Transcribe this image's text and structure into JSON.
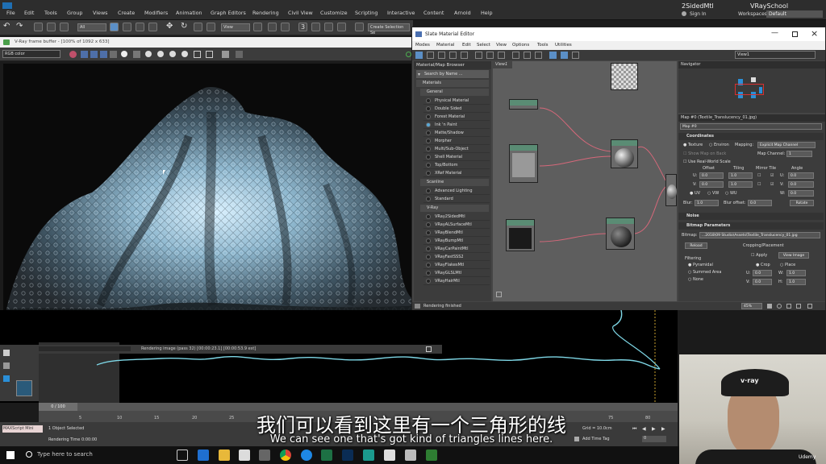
{
  "app": {
    "title_file": "2SidedMtl",
    "title_account": "VRaySchool",
    "sign_in": "Sign In",
    "workspaces_label": "Workspaces:",
    "workspaces_value": "Default"
  },
  "main_menu": [
    "File",
    "Edit",
    "Tools",
    "Group",
    "Views",
    "Create",
    "Modifiers",
    "Animation",
    "Graph Editors",
    "Rendering",
    "Civil View",
    "Customize",
    "Scripting",
    "Interactive",
    "Content",
    "Arnold",
    "Help"
  ],
  "toolbar": {
    "selection_filter": "All",
    "view_dropdown": "View",
    "create_selection_set": "Create Selection Se"
  },
  "frame_buffer": {
    "title": "V-Ray frame buffer - [100% of 1092 x 633]",
    "channel": "RGB color",
    "status": "Rendering image (pass 32) [00:00:23.1] [00:00:53.9 est]"
  },
  "slate": {
    "title": "Slate Material Editor",
    "menus": [
      "Modes",
      "Material",
      "Edit",
      "Select",
      "View",
      "Options",
      "Tools",
      "Utilities"
    ],
    "browser_title": "Material/Map Browser",
    "search_placeholder": "Search by Name ...",
    "materials_header": "Materials",
    "general_header": "General",
    "general_items": [
      "Physical Material",
      "Double Sided",
      "Forest Material",
      "Ink 'n Paint",
      "Matte/Shadow",
      "Morpher",
      "Multi/Sub-Object",
      "Shell Material",
      "Top/Bottom",
      "XRef Material"
    ],
    "scanline_header": "Scanline",
    "scanline_items": [
      "Advanced Lighting",
      "Standard"
    ],
    "vray_header": "V-Ray",
    "vray_items": [
      "VRay2SidedMtl",
      "VRayALSurfaceMtl",
      "VRayBlendMtl",
      "VRayBumpMtl",
      "VRayCarPaintMtl",
      "VRayFastSSS2",
      "VRayFlakesMtl",
      "VRayGLSLMtl",
      "VRayHairMtl"
    ],
    "view_tab": "View1",
    "view_dropdown": "View1",
    "navigator_title": "Navigator",
    "map_title": "Map #0 (Textile_Translucency_01.jpg)",
    "map_name": "Map #0",
    "status": "Rendering finished",
    "zoom": "45%",
    "coordinates": {
      "header": "Coordinates",
      "texture": "Texture",
      "environ": "Environ",
      "mapping_label": "Mapping:",
      "mapping_value": "Explicit Map Channel",
      "show_map": "Show Map on Back",
      "map_channel_label": "Map Channel:",
      "map_channel_value": "1",
      "use_real_world": "Use Real-World Scale",
      "offset": "Offset",
      "tiling": "Tiling",
      "mirror_tile": "Mirror Tile",
      "angle": "Angle",
      "u_label": "U:",
      "v_label": "V:",
      "w_label": "W:",
      "u_offset": "0.0",
      "v_offset": "0.0",
      "u_tiling": "1.0",
      "v_tiling": "1.0",
      "u_angle": "0.0",
      "v_angle": "0.0",
      "w_angle": "0.0",
      "uv": "UV",
      "vw": "VW",
      "wu": "WU",
      "blur_label": "Blur:",
      "blur_value": "1.0",
      "blur_offset_label": "Blur offset:",
      "blur_offset_value": "0.0",
      "rotate": "Rotate"
    },
    "noise_header": "Noise",
    "bitmap": {
      "header": "Bitmap Parameters",
      "bitmap_label": "Bitmap:",
      "bitmap_path": "...2018\\09 Studio\\Assets\\Textile_Translucency_01.jpg",
      "reload": "Reload",
      "cropping": "Cropping/Placement",
      "apply": "Apply",
      "view_image": "View Image",
      "filtering": "Filtering",
      "pyramidal": "Pyramidal",
      "summed_area": "Summed Area",
      "none": "None",
      "crop": "Crop",
      "place": "Place",
      "u_label": "U:",
      "v_label": "V:",
      "w_label": "W:",
      "h_label": "H:",
      "u_val": "0.0",
      "v_val": "0.0",
      "w_val": "1.0",
      "h_val": "1.0"
    }
  },
  "timeline": {
    "frame_counter": "0 / 100",
    "ticks": [
      "5",
      "10",
      "15",
      "20",
      "25",
      "30",
      "75",
      "80"
    ],
    "maxscript": "MAXScript Mini",
    "selected": "1 Object Selected",
    "rendering_time": "Rendering Time 0:00:00",
    "grid": "Grid = 10.0cm",
    "add_time_tag": "Add Time Tag",
    "frame_field": "0"
  },
  "taskbar": {
    "search": "Type here to search"
  },
  "subtitles": {
    "zh": "我们可以看到这里有一个三角形的线",
    "en": "We can see one that's got kind of triangles lines here."
  },
  "webcam": {
    "cap_logo": "v·ray",
    "watermark": "Udemy"
  }
}
